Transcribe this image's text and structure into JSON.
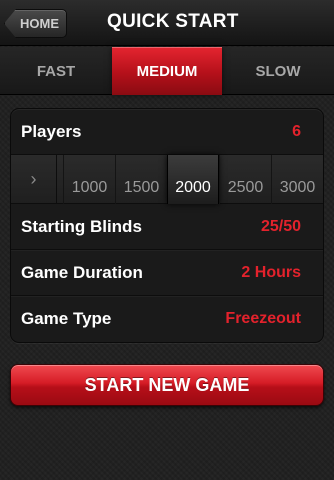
{
  "header": {
    "home_label": "HOME",
    "title": "QUICK START"
  },
  "speed_tabs": [
    {
      "label": "FAST",
      "selected": false
    },
    {
      "label": "MEDIUM",
      "selected": true
    },
    {
      "label": "SLOW",
      "selected": false
    }
  ],
  "settings": {
    "players": {
      "label": "Players",
      "value": "6"
    },
    "chip_options": [
      "1000",
      "1500",
      "2000",
      "2500",
      "3000"
    ],
    "chip_selected": "2000",
    "starting_blinds": {
      "label": "Starting Blinds",
      "value": "25/50"
    },
    "game_duration": {
      "label": "Game Duration",
      "value": "2 Hours"
    },
    "game_type": {
      "label": "Game Type",
      "value": "Freezeout"
    }
  },
  "start_button_label": "START NEW GAME",
  "colors": {
    "accent_red": "#e3222c",
    "background": "#1f1f1f"
  },
  "icons": {
    "selector_arrow": "chevron-right-icon",
    "watermark": "spade-icon"
  }
}
